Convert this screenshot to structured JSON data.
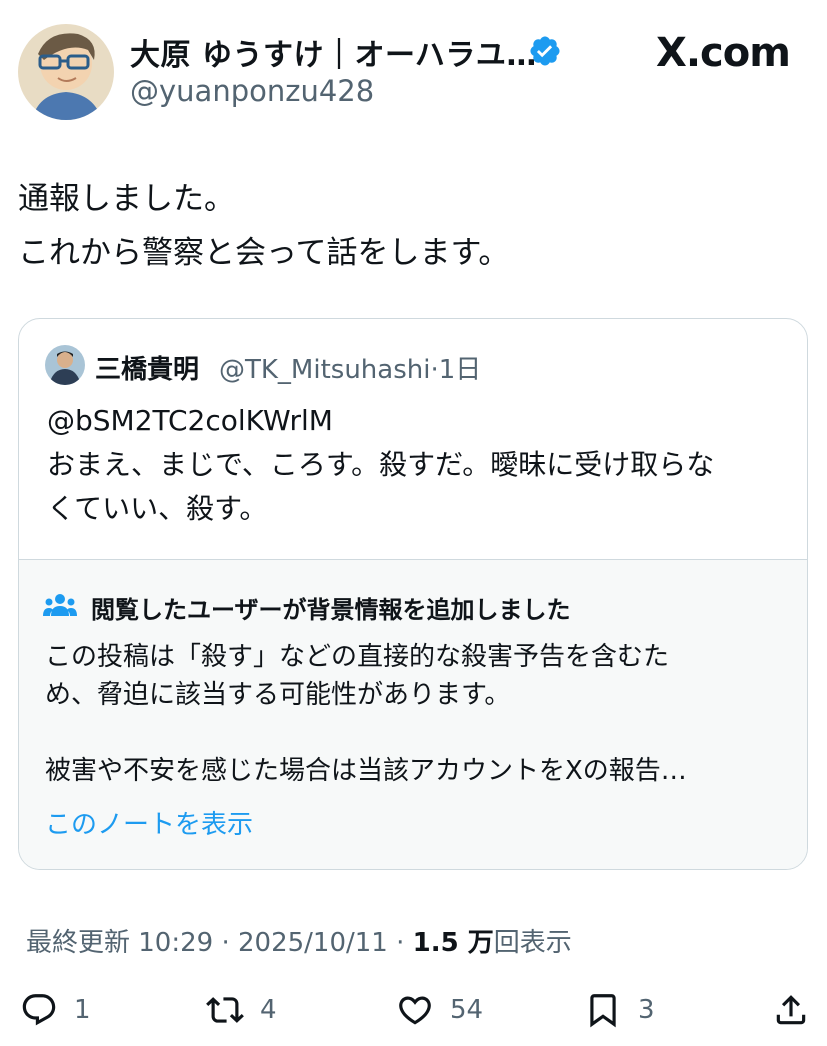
{
  "header": {
    "display_name": "大原 ゆうすけ｜オーハラユ…",
    "handle": "@yuanponzu428",
    "brand": "X.com",
    "verified_color": "#1d9bf0"
  },
  "post": {
    "lines": [
      "通報しました。",
      "これから警察と会って話をします。"
    ]
  },
  "quote": {
    "name": "三橋貴明",
    "handle_time": "@TK_Mitsuhashi·1日",
    "lines": [
      "@bSM2TC2colKWrlM",
      "おまえ、まじで、ころす。殺すだ。曖昧に受け取らな",
      "くていい、殺す。"
    ],
    "note": {
      "header": "閲覧したユーザーが背景情報を追加しました",
      "lines": [
        "この投稿は「殺す」などの直接的な殺害予告を含むた",
        "め、脅迫に該当する可能性があります。",
        "",
        "被害や不安を感じた場合は当該アカウントをXの報告…"
      ],
      "link": "このノートを表示"
    }
  },
  "meta": {
    "updated": "最終更新 10:29 · 2025/10/11 · ",
    "views_count": "1.5 万",
    "views_label": "回表示"
  },
  "actions": {
    "replies": "1",
    "reposts": "4",
    "likes": "54",
    "bookmarks": "3"
  }
}
